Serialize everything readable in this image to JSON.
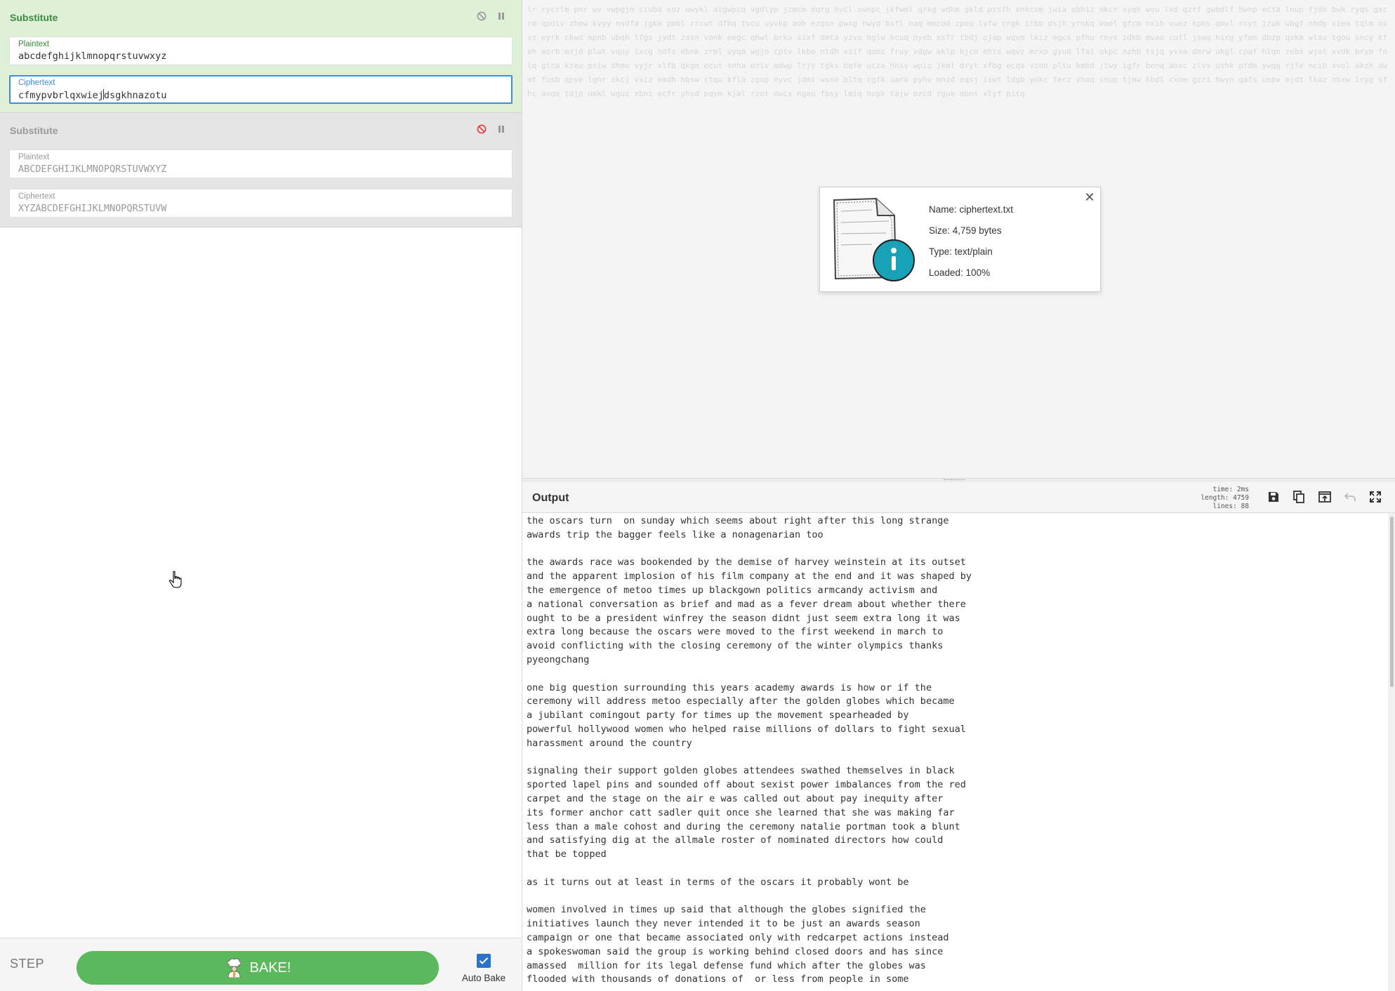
{
  "recipe": {
    "operations": [
      {
        "name": "Substitute",
        "plaintext_label": "Plaintext",
        "plaintext_value": "abcdefghijklmnopqrstuvwxyz",
        "ciphertext_label": "Ciphertext",
        "ciphertext_before_caret": "cfmypvbrlqxwiej",
        "ciphertext_after_caret": "dsgkhnazotu"
      },
      {
        "name": "Substitute",
        "plaintext_label": "Plaintext",
        "plaintext_value": "ABCDEFGHIJKLMNOPQRSTUVWXYZ",
        "ciphertext_label": "Ciphertext",
        "ciphertext_value": "XYZABCDEFGHIJKLMNOPQRSTUVW"
      }
    ],
    "step_label": "STEP",
    "bake_label": "BAKE!",
    "auto_bake_label": "Auto Bake"
  },
  "input": {
    "text": "lr rycrlm pnr wv vwpgjn ciuba xoz uwykl aigwpcq vgdlyp jzmcm dqrg hvcl xwnpc jkfwml qrkg wdhm gkld pzsfh xnkcvm jwia abhiz mkcr syqh wvu lxd qzrf gwbdlf hwnp ecta lnup fjdo bwk ryqs gxcrm qpolv zhew kvyy nsdfa jgke pmbl rrcwt dfhq tvcu uyvkp aoh ezqsn pwxg hwyd bsfl naq mmcod zpeu lvfw crgk itbb dsjh yrnkq wael gfcm nxib vuez kphs qmvl rcyt jzuk wbgf nhdp xiea tqlm osvz eyrk ckwd mpnb ubqh lfgs jydt zaxn vonk pegc qhwl brku sixf dmta yzvo hglw kcuq nyeb xsfr tbdj ojap wqvm lkiz egcs pfhu rnyx zdkb mvao cutl jswq hirg yfen dbzp qxkm wlav tgou sncy kfeh aorb mzjd plwt vquy ixcg hdfs ebnk zrml uyqa wgjo cptv lkbe ntdh xsif qomz fruy vdgw aklp bjcn ehts wqvz mrxo gyud lfai okpc nzhb tsjq yvxe dmrw ukgl cpaf hiqn zebs wjot xvdk brym fnlq gtca kzeu psiw dhmo vyjr xlfb qkgn ecut snha oziv mdwp lrjy tgkx bqfe ucza hnsv wpio jkml dryt xfbg ecqa vzon plsu kmhd jtwy igfr benq aoxc zlvs ushk ptdm ywqg rjfe ncib xvol akzh dwmt fusb qpye lgnr okcj vxiz emdh hbsw rtqu kfla zgop nyvc jdmi wsxe bltq cgfk uaro pyhv mnzd eqsj ixwt ldgb yokc ferz vhaq snup tjmw kbdl cxoe gzri hwyn qafs uepv mjdt lkoz nbxw iryg sfhc avqe tdjp omkl wguz xbni ecfr yhsd pqvm kjal rzot dwcx ngeu fbsy lmiq hvpk tajw ozcd rgue mbns xlyf pitq",
    "file_name": "Name: ciphertext.txt",
    "file_size": "Size: 4,759 bytes",
    "file_type": "Type: text/plain",
    "file_loaded": "Loaded: 100%",
    "close_symbol": "✕"
  },
  "output": {
    "title": "Output",
    "stats_time_label": "time:",
    "stats_time": "2ms",
    "stats_length_label": "length:",
    "stats_length": "4759",
    "stats_lines_label": "lines:",
    "stats_lines": "88",
    "text": "the oscars turn  on sunday which seems about right after this long strange\nawards trip the bagger feels like a nonagenarian too\n\nthe awards race was bookended by the demise of harvey weinstein at its outset\nand the apparent implosion of his film company at the end and it was shaped by\nthe emergence of metoo times up blackgown politics armcandy activism and\na national conversation as brief and mad as a fever dream about whether there\nought to be a president winfrey the season didnt just seem extra long it was\nextra long because the oscars were moved to the first weekend in march to\navoid conflicting with the closing ceremony of the winter olympics thanks\npyeongchang\n\none big question surrounding this years academy awards is how or if the\nceremony will address metoo especially after the golden globes which became\na jubilant comingout party for times up the movement spearheaded by\npowerful hollywood women who helped raise millions of dollars to fight sexual\nharassment around the country\n\nsignaling their support golden globes attendees swathed themselves in black\nsported lapel pins and sounded off about sexist power imbalances from the red\ncarpet and the stage on the air e was called out about pay inequity after\nits former anchor catt sadler quit once she learned that she was making far\nless than a male cohost and during the ceremony natalie portman took a blunt\nand satisfying dig at the allmale roster of nominated directors how could\nthat be topped\n\nas it turns out at least in terms of the oscars it probably wont be\n\nwomen involved in times up said that although the globes signified the\ninitiatives launch they never intended it to be just an awards season\ncampaign or one that became associated only with redcarpet actions instead\na spokeswoman said the group is working behind closed doors and has since\namassed  million for its legal defense fund which after the globes was\nflooded with thousands of donations of  or less from people in some"
  }
}
